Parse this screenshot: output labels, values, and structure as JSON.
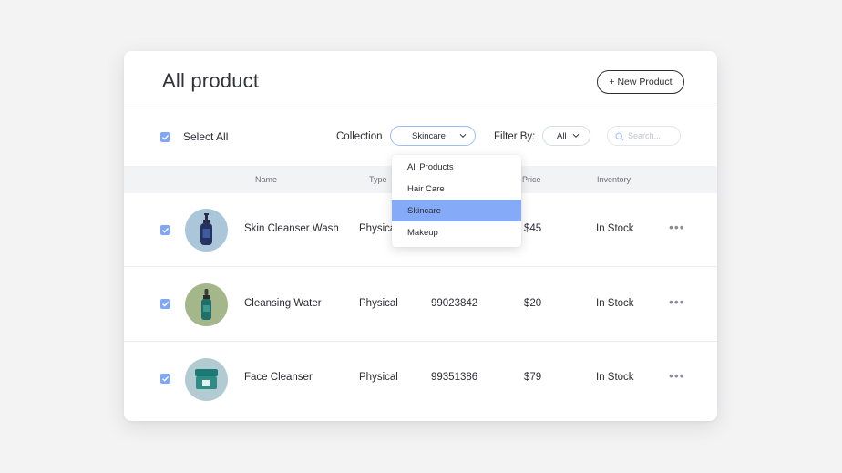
{
  "page": {
    "title": "All product",
    "new_button_label": "+ New Product"
  },
  "toolbar": {
    "select_all_label": "Select All",
    "collection_label": "Collection",
    "collection_value": "Skincare",
    "filter_label": "Filter By:",
    "filter_value": "All",
    "search_placeholder": "Search..."
  },
  "table": {
    "headers": [
      "Name",
      "Type",
      "Price",
      "Inventory"
    ],
    "rows": [
      {
        "name": "Skin Cleanser Wash",
        "type": "Physical",
        "sku": "",
        "price": "$45",
        "inventory": "In Stock",
        "checked": true,
        "thumb": "bottle-pump"
      },
      {
        "name": "Cleansing Water",
        "type": "Physical",
        "sku": "99023842",
        "price": "$20",
        "inventory": "In Stock",
        "checked": true,
        "thumb": "bottle-dropper"
      },
      {
        "name": "Face Cleanser",
        "type": "Physical",
        "sku": "99351386",
        "price": "$79",
        "inventory": "In Stock",
        "checked": true,
        "thumb": "jar"
      }
    ]
  },
  "collection_dropdown": {
    "open": true,
    "options": [
      "All Products",
      "Hair Care",
      "Skincare",
      "Makeup"
    ],
    "selected": "Skincare"
  },
  "colors": {
    "accent": "#85abf8",
    "checkbox": "#7fa7f3",
    "background": "#f3f3f4",
    "header_row": "#f2f3f5"
  },
  "icons": [
    "check-icon",
    "chevron-down-icon",
    "search-icon",
    "more-icon"
  ]
}
